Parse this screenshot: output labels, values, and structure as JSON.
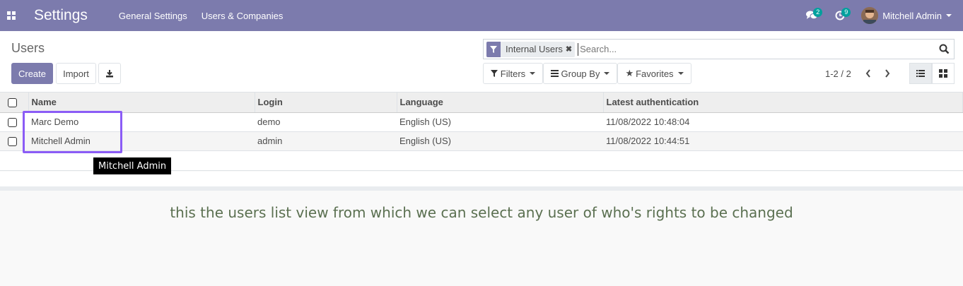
{
  "navbar": {
    "app_name": "Settings",
    "menu": [
      "General Settings",
      "Users & Companies"
    ],
    "messages_count": "2",
    "activities_count": "9",
    "user_name": "Mitchell Admin"
  },
  "control_panel": {
    "breadcrumb": "Users",
    "create_label": "Create",
    "import_label": "Import",
    "facet_label": "Internal Users",
    "search_placeholder": "Search...",
    "filters_label": "Filters",
    "group_by_label": "Group By",
    "favorites_label": "Favorites",
    "pager": "1-2 / 2"
  },
  "table": {
    "columns": [
      "Name",
      "Login",
      "Language",
      "Latest authentication"
    ],
    "rows": [
      {
        "name": "Marc Demo",
        "login": "demo",
        "language": "English (US)",
        "latest_auth": "11/08/2022 10:48:04"
      },
      {
        "name": "Mitchell Admin",
        "login": "admin",
        "language": "English (US)",
        "latest_auth": "11/08/2022 10:44:51"
      }
    ]
  },
  "tooltip": "Mitchell Admin",
  "caption": "this the users list view from which we can select any user of who's rights to be changed",
  "colors": {
    "brand": "#7c7bad",
    "highlight": "#8b5cf6",
    "badge": "#00a09d",
    "caption": "#5b7051"
  }
}
